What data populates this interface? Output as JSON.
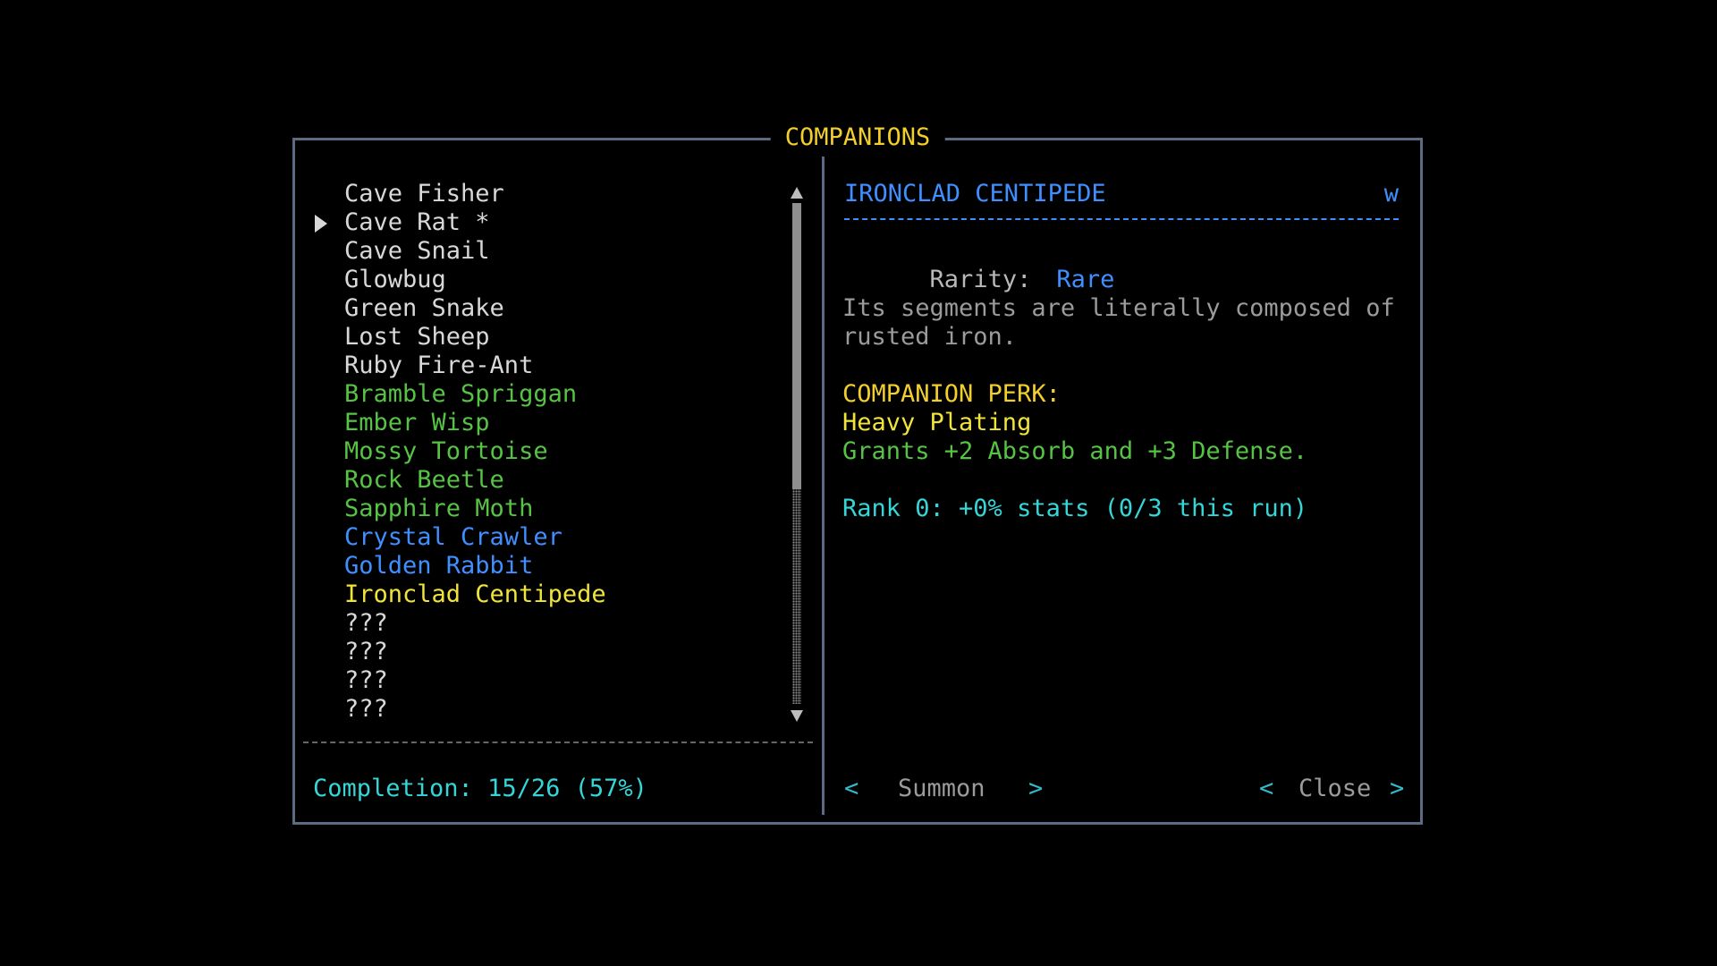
{
  "dialog": {
    "title": "COMPANIONS"
  },
  "list": {
    "items": [
      {
        "label": "Cave Fisher",
        "color": "#d8d8d8",
        "selected": false
      },
      {
        "label": "Cave Rat *",
        "color": "#d8d8d8",
        "selected": true
      },
      {
        "label": "Cave Snail",
        "color": "#d8d8d8",
        "selected": false
      },
      {
        "label": "Glowbug",
        "color": "#d8d8d8",
        "selected": false
      },
      {
        "label": "Green Snake",
        "color": "#d8d8d8",
        "selected": false
      },
      {
        "label": "Lost Sheep",
        "color": "#d8d8d8",
        "selected": false
      },
      {
        "label": "Ruby Fire-Ant",
        "color": "#d8d8d8",
        "selected": false
      },
      {
        "label": "Bramble Spriggan",
        "color": "#56c345",
        "selected": false
      },
      {
        "label": "Ember Wisp",
        "color": "#56c345",
        "selected": false
      },
      {
        "label": "Mossy Tortoise",
        "color": "#56c345",
        "selected": false
      },
      {
        "label": "Rock Beetle",
        "color": "#56c345",
        "selected": false
      },
      {
        "label": "Sapphire Moth",
        "color": "#56c345",
        "selected": false
      },
      {
        "label": "Crystal Crawler",
        "color": "#3f8fff",
        "selected": false
      },
      {
        "label": "Golden Rabbit",
        "color": "#3f8fff",
        "selected": false
      },
      {
        "label": "Ironclad Centipede",
        "color": "#f0e43a",
        "selected": false
      },
      {
        "label": "???",
        "color": "#d8d8d8",
        "selected": false
      },
      {
        "label": "???",
        "color": "#d8d8d8",
        "selected": false
      },
      {
        "label": "???",
        "color": "#d8d8d8",
        "selected": false
      },
      {
        "label": "???",
        "color": "#d8d8d8",
        "selected": false
      }
    ],
    "selector_icon": "triangle-right-icon",
    "scrollbar": {
      "up_icon": "triangle-up-icon",
      "down_icon": "triangle-down-icon"
    },
    "completion": "Completion: 15/26 (57%)"
  },
  "detail": {
    "name": "IRONCLAD CENTIPEDE",
    "rarity_letter": "w",
    "rarity_label": "Rarity:",
    "rarity_value": "Rare",
    "description": "Its segments are literally composed of\nrusted iron.",
    "perk_heading": "COMPANION PERK:",
    "perk_name": "Heavy Plating",
    "perk_description": "Grants +2 Absorb and +3 Defense.",
    "rank_line": "Rank 0: +0% stats (0/3 this run)"
  },
  "actions": {
    "summon": {
      "left": "<",
      "label": "Summon",
      "right": ">"
    },
    "close": {
      "left": "<",
      "label": "Close",
      "right": ">"
    }
  },
  "colors": {
    "border": "#5d6a82",
    "title": "#f2cf2c",
    "common": "#d8d8d8",
    "uncommon": "#56c345",
    "rare": "#3f8fff",
    "legendary": "#f0e43a",
    "accent": "#35d5d8"
  }
}
